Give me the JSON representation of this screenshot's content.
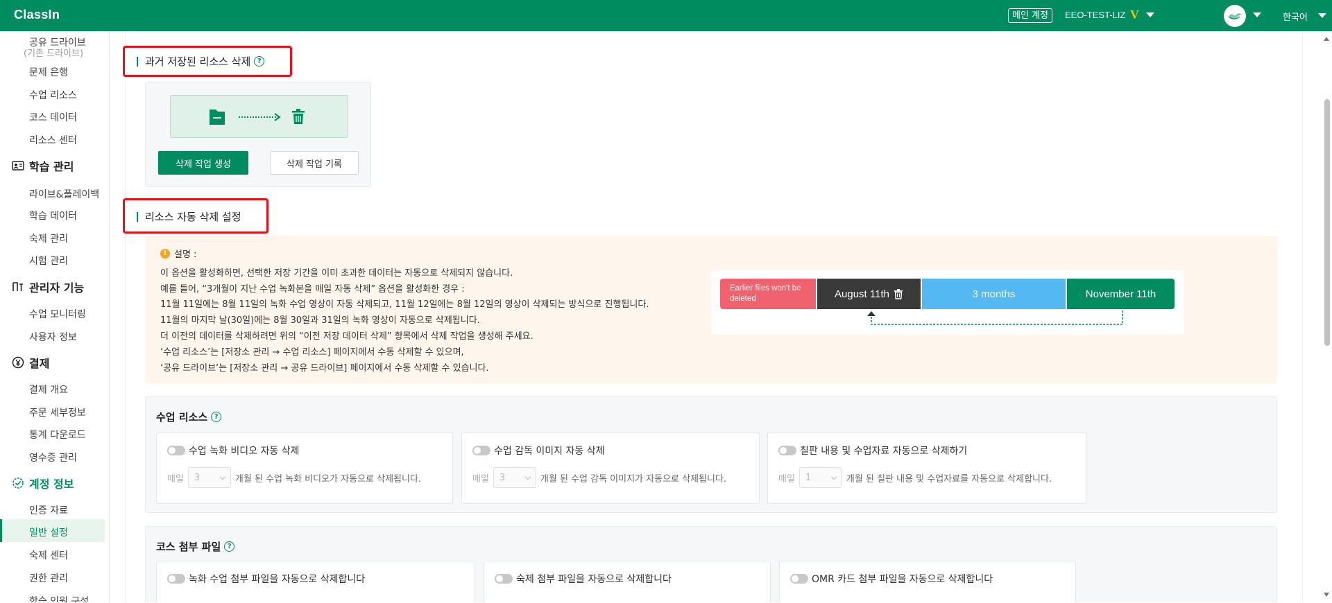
{
  "header": {
    "logo": "ClassIn",
    "main_account": "메인 계정",
    "user_name": "EEO-TEST-LIZ",
    "vip_badge": "V",
    "language": "한국어"
  },
  "sidebar": {
    "shared_drive": "공유 드라이브",
    "shared_drive_sub": "(기존 드라이브)",
    "question_bank": "문제 은행",
    "class_resources": "수업 리소스",
    "course_data": "코스 데이터",
    "resource_center": "리소스 센터",
    "learning_mgmt": "학습 관리",
    "live_playback": "라이브&플레이백",
    "learning_data": "학습 데이터",
    "homework_mgmt": "숙제 관리",
    "exam_mgmt": "시험 관리",
    "admin_features": "관리자 기능",
    "class_monitoring": "수업 모니터링",
    "user_info": "사용자 정보",
    "payment": "결제",
    "payment_overview": "결제 개요",
    "order_details": "주문 세부정보",
    "stats_download": "통계 다운로드",
    "receipt_mgmt": "영수증 관리",
    "account_info": "계정 정보",
    "certification": "인증 자료",
    "general_settings": "일반 설정",
    "homework_center": "숙제 센터",
    "permission_mgmt": "권한 관리",
    "school_member": "학습 인원 구성"
  },
  "past_delete": {
    "title": "과거 저장된 리소스 삭제",
    "create_button": "삭제 작업 생성",
    "history_button": "삭제 작업 기록"
  },
  "auto_delete": {
    "title": "리소스 자동 삭제 설정"
  },
  "notice": {
    "heading": "설명 :",
    "lines": [
      "이 옵션을 활성화하면, 선택한 저장 기간을 이미 초과한 데이터는 자동으로 삭제되지 않습니다.",
      "예를 들어, “3개월이 지난 수업 녹화본을 매일 자동 삭제” 옵션을 활성화한 경우 :",
      "11월 11일에는 8월 11일의 녹화 수업 영상이 자동 삭제되고, 11월 12일에는 8월 12일의 영상이 삭제되는 방식으로 진행됩니다.",
      "11월의 마지막 날(30일)에는 8월 30일과 31일의 녹화 영상이 자동으로 삭제됩니다.",
      "더 이전의 데이터를 삭제하려면 위의 “이전 저장 데이터 삭제” 항목에서 삭제 작업을 생성해 주세요.",
      "‘수업 리소스’는 [저장소 관리 → 수업 리소스] 페이지에서 수동 삭제할 수 있으며,",
      "‘공유 드라이브’는 [저장소 관리 → 공유 드라이브] 페이지에서 수동 삭제할 수 있습니다."
    ]
  },
  "timeline": {
    "seg1": "Earlier files won't be deleted",
    "seg2": "August 11th",
    "seg3": "3 months",
    "seg4": "November 11th"
  },
  "class_resources": {
    "title": "수업 리소스",
    "cards": [
      {
        "title": "수업 녹화 비디오 자동 삭제",
        "prefix": "매일",
        "value": "3",
        "suffix": "개월 된 수업 녹화 비디오가 자동으로 삭제됩니다."
      },
      {
        "title": "수업 감독 이미지 자동 삭제",
        "prefix": "매일",
        "value": "3",
        "suffix": "개월 된 수업 감독 이미지가 자동으로 삭제됩니다."
      },
      {
        "title": "칠판 내용 및 수업자료 자동으로 삭제하기",
        "prefix": "매일",
        "value": "1",
        "suffix": "개월 된 칠판 내용 및 수업자료를 자동으로 삭제합니다."
      }
    ]
  },
  "course_attachments": {
    "title": "코스 첨부 파일",
    "cards": [
      {
        "title": "녹화 수업 첨부 파일을 자동으로 삭제합니다"
      },
      {
        "title": "숙제 첨부 파일을 자동으로 삭제합니다"
      },
      {
        "title": "OMR 카드 첨부 파일을 자동으로 삭제합니다"
      }
    ]
  },
  "colors": {
    "brand": "#008c5e",
    "highlight": "#e8111a",
    "notice_bg": "#fef6ec",
    "tl_red": "#f0636e",
    "tl_dark": "#3a3a3a",
    "tl_blue": "#54b8f3"
  }
}
